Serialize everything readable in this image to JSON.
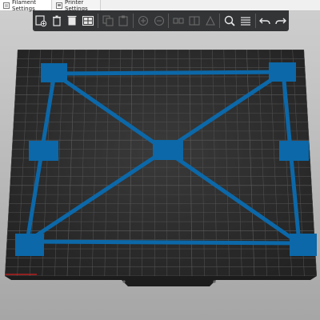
{
  "tabs": [
    {
      "label": "Filament Settings",
      "icon": "filament-settings-icon",
      "active": true
    },
    {
      "label": "Printer Settings",
      "icon": "printer-settings-icon",
      "active": false
    }
  ],
  "toolbar": {
    "buttons": [
      {
        "name": "add-icon",
        "enabled": true
      },
      {
        "name": "delete-icon",
        "enabled": true
      },
      {
        "name": "delete-all-icon",
        "enabled": true
      },
      {
        "name": "arrange-icon",
        "enabled": true
      },
      {
        "name": "copy-icon",
        "enabled": false
      },
      {
        "name": "paste-icon",
        "enabled": false
      },
      {
        "name": "add-instance-icon",
        "enabled": false
      },
      {
        "name": "remove-instance-icon",
        "enabled": false
      },
      {
        "name": "split-objects-icon",
        "enabled": false
      },
      {
        "name": "split-parts-icon",
        "enabled": false
      },
      {
        "name": "variable-layer-height-icon",
        "enabled": false
      },
      {
        "name": "search-icon",
        "enabled": true
      },
      {
        "name": "layers-editing-icon",
        "enabled": true
      },
      {
        "name": "undo-icon",
        "enabled": true
      },
      {
        "name": "redo-icon",
        "enabled": true
      }
    ]
  },
  "colors": {
    "bed": "#2b2b2b",
    "grid_line": "#4a4a4a",
    "model": "#0c68a8",
    "toolbar_bg": "#333436"
  }
}
